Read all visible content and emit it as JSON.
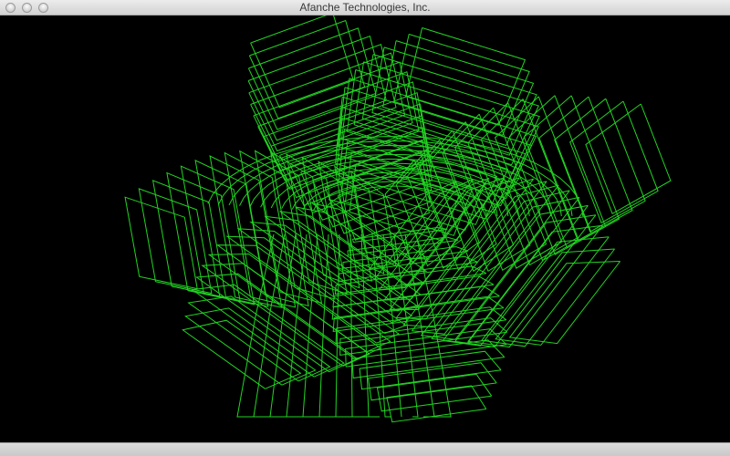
{
  "window": {
    "title": "Afanche Technologies, Inc."
  },
  "visualization": {
    "background_color": "#000000",
    "stroke_color": "#22d422",
    "style": "green wireframe"
  }
}
